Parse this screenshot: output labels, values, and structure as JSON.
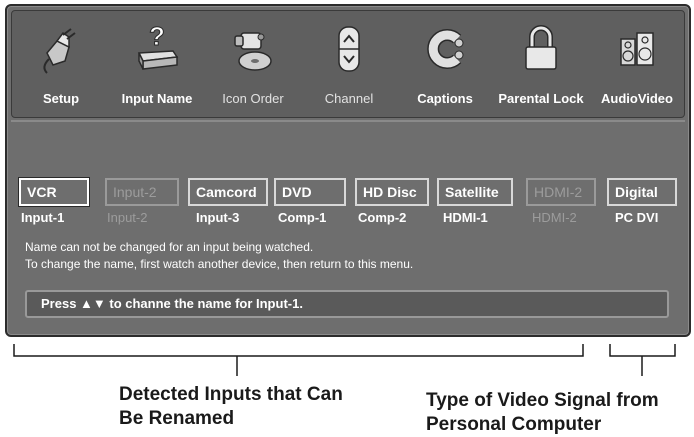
{
  "menu": {
    "items": [
      {
        "label": "Setup",
        "icon": "plug-icon"
      },
      {
        "label": "Input Name",
        "icon": "question-device-icon"
      },
      {
        "label": "Icon Order",
        "icon": "camcorder-disc-icon"
      },
      {
        "label": "Channel",
        "icon": "up-down-arrows-icon"
      },
      {
        "label": "Captions",
        "icon": "captions-c-icon"
      },
      {
        "label": "Parental Lock",
        "icon": "padlock-icon"
      },
      {
        "label": "AudioVideo",
        "icon": "speakers-icon"
      }
    ]
  },
  "inputs": [
    {
      "name": "VCR",
      "source": "Input-1",
      "state": "selected"
    },
    {
      "name": "Input-2",
      "source": "Input-2",
      "state": "disabled"
    },
    {
      "name": "Camcord",
      "source": "Input-3",
      "state": "normal"
    },
    {
      "name": "DVD",
      "source": "Comp-1",
      "state": "normal"
    },
    {
      "name": "HD Disc",
      "source": "Comp-2",
      "state": "normal"
    },
    {
      "name": "Satellite",
      "source": "HDMI-1",
      "state": "normal"
    },
    {
      "name": "HDMI-2",
      "source": "HDMI-2",
      "state": "disabled"
    },
    {
      "name": "Digital",
      "source": "PC DVI",
      "state": "normal"
    }
  ],
  "notes": {
    "line1": "Name can not be changed for an input being watched.",
    "line2": "To change the name, first watch another device, then return to this menu."
  },
  "status": {
    "text": "Press ▲▼ to channe the name for Input-1."
  },
  "callouts": {
    "left_line1": "Detected Inputs that Can",
    "left_line2": "Be Renamed",
    "right_line1": "Type of Video Signal from",
    "right_line2": "Personal Computer"
  },
  "colors": {
    "panel": "#6e6e6e",
    "menu_bar": "#5f5f5f",
    "text": "#ffffff",
    "disabled_text": "#9c9c9c"
  }
}
